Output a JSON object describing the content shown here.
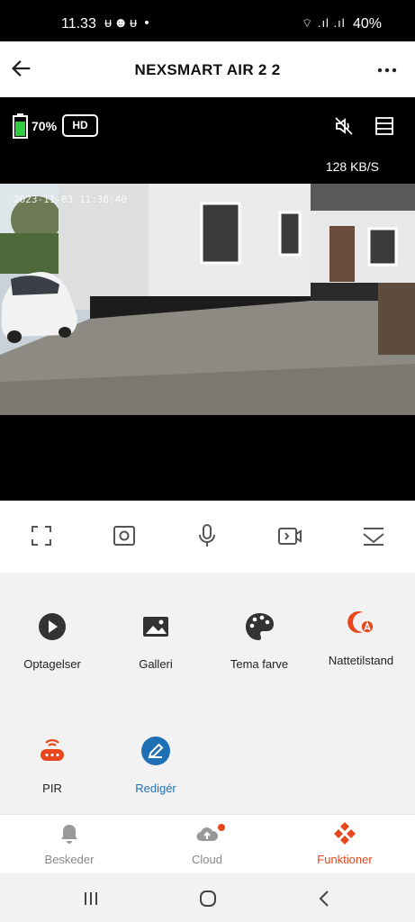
{
  "status_bar": {
    "time": "11.33",
    "notification_icons": "ᵾ☻ᵾ •",
    "signal": "⌔ .ıl .ıl",
    "battery": "40%"
  },
  "app_bar": {
    "title": "NEXSMART AIR 2 2",
    "back_icon": "arrow-left-icon",
    "more_icon": "more-horizontal-icon"
  },
  "video": {
    "battery_percent": "70%",
    "quality": "HD",
    "speed": "128 KB/S",
    "timestamp": "2023-11-03 11:38:40",
    "icons": [
      "battery-icon",
      "mute-icon",
      "layout-icon"
    ]
  },
  "controls": [
    "fullscreen-icon",
    "snapshot-icon",
    "microphone-icon",
    "record-icon",
    "collapse-icon"
  ],
  "features": {
    "items": [
      {
        "label": "Optagelser",
        "icon": "play-circle-icon"
      },
      {
        "label": "Galleri",
        "icon": "image-icon"
      },
      {
        "label": "Tema farve",
        "icon": "palette-icon"
      },
      {
        "label": "Nattetilstand",
        "icon": "night-auto-icon"
      },
      {
        "label": "PIR",
        "icon": "pir-sensor-icon"
      },
      {
        "label": "Redigér",
        "icon": "edit-icon"
      }
    ]
  },
  "tabbar": {
    "tabs": [
      {
        "label": "Beskeder",
        "icon": "bell-icon"
      },
      {
        "label": "Cloud",
        "icon": "cloud-upload-icon"
      },
      {
        "label": "Funktioner",
        "icon": "functions-icon"
      }
    ],
    "active_color": "#e8461c"
  },
  "colors": {
    "accent": "#e8461c",
    "edit_blue": "#1f6fb5",
    "battery_green": "#2ecc40"
  }
}
